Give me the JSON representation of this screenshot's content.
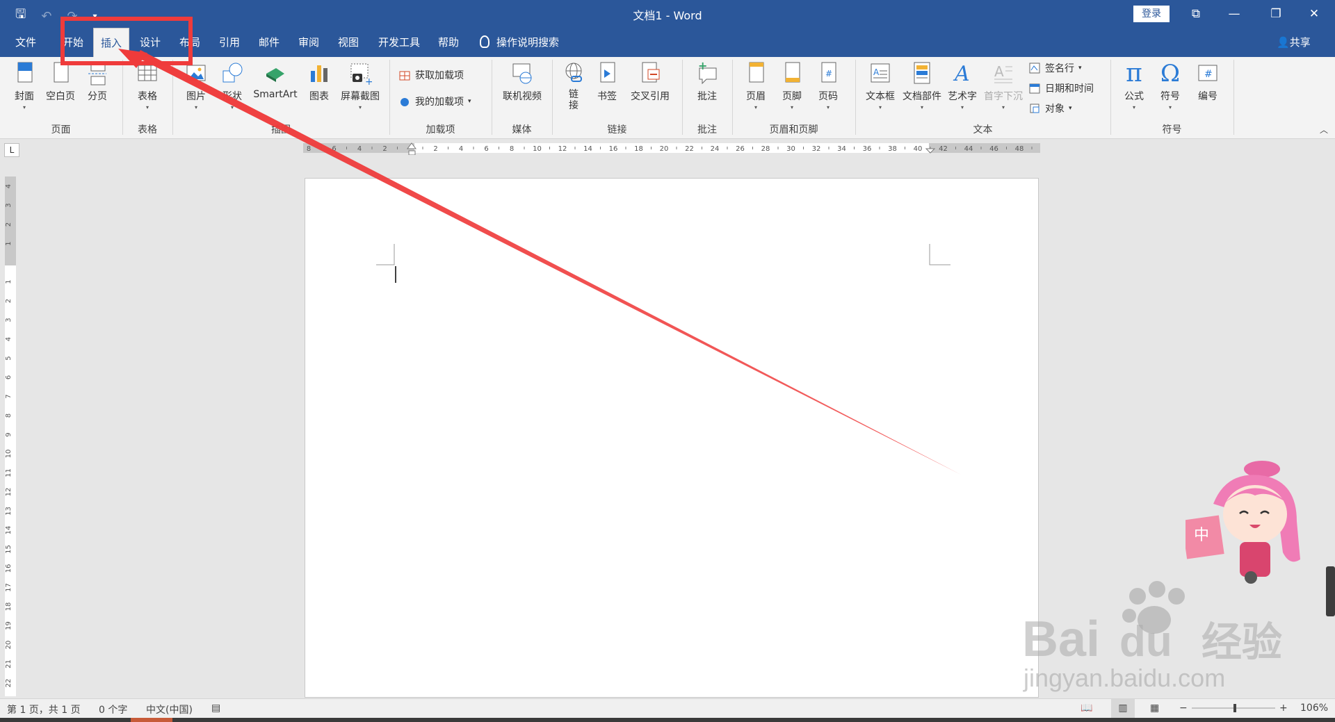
{
  "window": {
    "doc_title": "文档1  -  Word",
    "login_label": "登录",
    "controls": {
      "ribbon_options": "⧉",
      "minimize": "—",
      "restore": "❐",
      "close": "✕"
    }
  },
  "qat": {
    "save": "🖫",
    "undo": "↶",
    "redo": "↷",
    "customize": "▾"
  },
  "tabs": [
    {
      "label": "文件"
    },
    {
      "label": "开始"
    },
    {
      "label": "插入"
    },
    {
      "label": "设计"
    },
    {
      "label": "布局"
    },
    {
      "label": "引用"
    },
    {
      "label": "邮件"
    },
    {
      "label": "审阅"
    },
    {
      "label": "视图"
    },
    {
      "label": "开发工具"
    },
    {
      "label": "帮助"
    }
  ],
  "tell_me": "操作说明搜索",
  "share": "共享",
  "ribbon": {
    "pages": {
      "label": "页面",
      "cover": "封面",
      "blank": "空白页",
      "break": "分页"
    },
    "tables": {
      "label": "表格",
      "table": "表格"
    },
    "illustrations": {
      "label": "插图",
      "pictures": "图片",
      "shapes": "形状",
      "smartart": "SmartArt",
      "chart": "图表",
      "screenshot": "屏幕截图"
    },
    "addins": {
      "label": "加载项",
      "get": "获取加载项",
      "mine": "我的加载项"
    },
    "media": {
      "label": "媒体",
      "online_video": "联机视频"
    },
    "links": {
      "label": "链接",
      "link_1": "链",
      "link_2": "接",
      "bookmark": "书签",
      "cross_ref": "交叉引用"
    },
    "comments": {
      "label": "批注",
      "comment": "批注"
    },
    "header_footer": {
      "label": "页眉和页脚",
      "header": "页眉",
      "footer": "页脚",
      "page_number": "页码"
    },
    "text": {
      "label": "文本",
      "textbox": "文本框",
      "quick_parts": "文档部件",
      "wordart": "艺术字",
      "dropcap": "首字下沉",
      "signature": "签名行",
      "datetime": "日期和时间",
      "object": "对象"
    },
    "symbols": {
      "label": "符号",
      "equation": "公式",
      "symbol": "符号",
      "number": "编号",
      "pi": "π",
      "omega": "Ω"
    }
  },
  "ruler": {
    "h_labels": [
      "8",
      "6",
      "4",
      "2",
      "",
      "2",
      "4",
      "6",
      "8",
      "10",
      "12",
      "14",
      "16",
      "18",
      "20",
      "22",
      "24",
      "26",
      "28",
      "30",
      "32",
      "34",
      "36",
      "38",
      "40",
      "42",
      "44",
      "46",
      "48"
    ],
    "v_labels": [
      "4",
      "3",
      "2",
      "1",
      "",
      "1",
      "2",
      "3",
      "4",
      "5",
      "6",
      "7",
      "8",
      "9",
      "10",
      "11",
      "12",
      "13",
      "14",
      "15",
      "16",
      "17",
      "18",
      "19",
      "20",
      "21",
      "22"
    ],
    "corner": "L"
  },
  "status": {
    "page": "第 1 页，共 1 页",
    "words": "0 个字",
    "language": "中文(中国)",
    "zoom": "106%",
    "zoom_minus": "−",
    "zoom_plus": "+"
  },
  "watermark": {
    "text": "Bai",
    "suffix": "du",
    "cn": "经验",
    "url": "jingyan.baidu.com"
  },
  "mascot_badge": "中",
  "colors": {
    "word_blue": "#2b579a",
    "annotation_red": "#ef3b3b",
    "ribbon_bg": "#f3f3f3",
    "canvas": "#e6e6e6"
  },
  "icons": {
    "save": "save-icon",
    "undo": "undo-icon",
    "redo": "redo-icon",
    "tell_me": "lightbulb-icon",
    "share": "person-icon",
    "cover": "cover-page-icon",
    "table": "table-grid-icon",
    "equation": "pi-icon",
    "symbol": "omega-icon"
  }
}
